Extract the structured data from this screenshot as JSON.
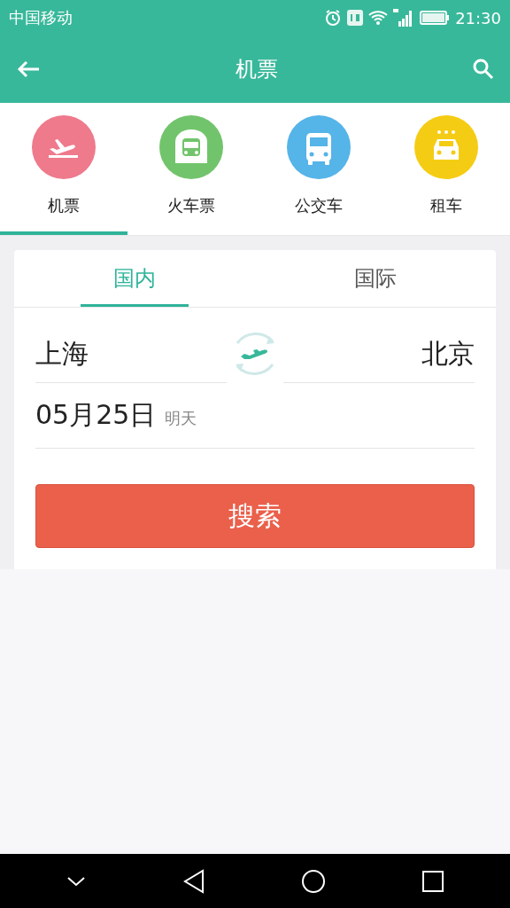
{
  "status_bar": {
    "carrier": "中国移动",
    "time": "21:30"
  },
  "app_bar": {
    "title": "机票"
  },
  "categories": [
    {
      "label": "机票",
      "kind": "plane",
      "color": "#ee7a8c",
      "selected": true
    },
    {
      "label": "火车票",
      "kind": "train",
      "color": "#72c46c",
      "selected": false
    },
    {
      "label": "公交车",
      "kind": "bus",
      "color": "#55b4e8",
      "selected": false
    },
    {
      "label": "租车",
      "kind": "car",
      "color": "#f5cc14",
      "selected": false
    }
  ],
  "tabs": [
    {
      "label": "国内",
      "selected": true
    },
    {
      "label": "国际",
      "selected": false
    }
  ],
  "route": {
    "from": "上海",
    "to": "北京"
  },
  "date": {
    "value": "05月25日",
    "hint": "明天"
  },
  "search_button": "搜索"
}
